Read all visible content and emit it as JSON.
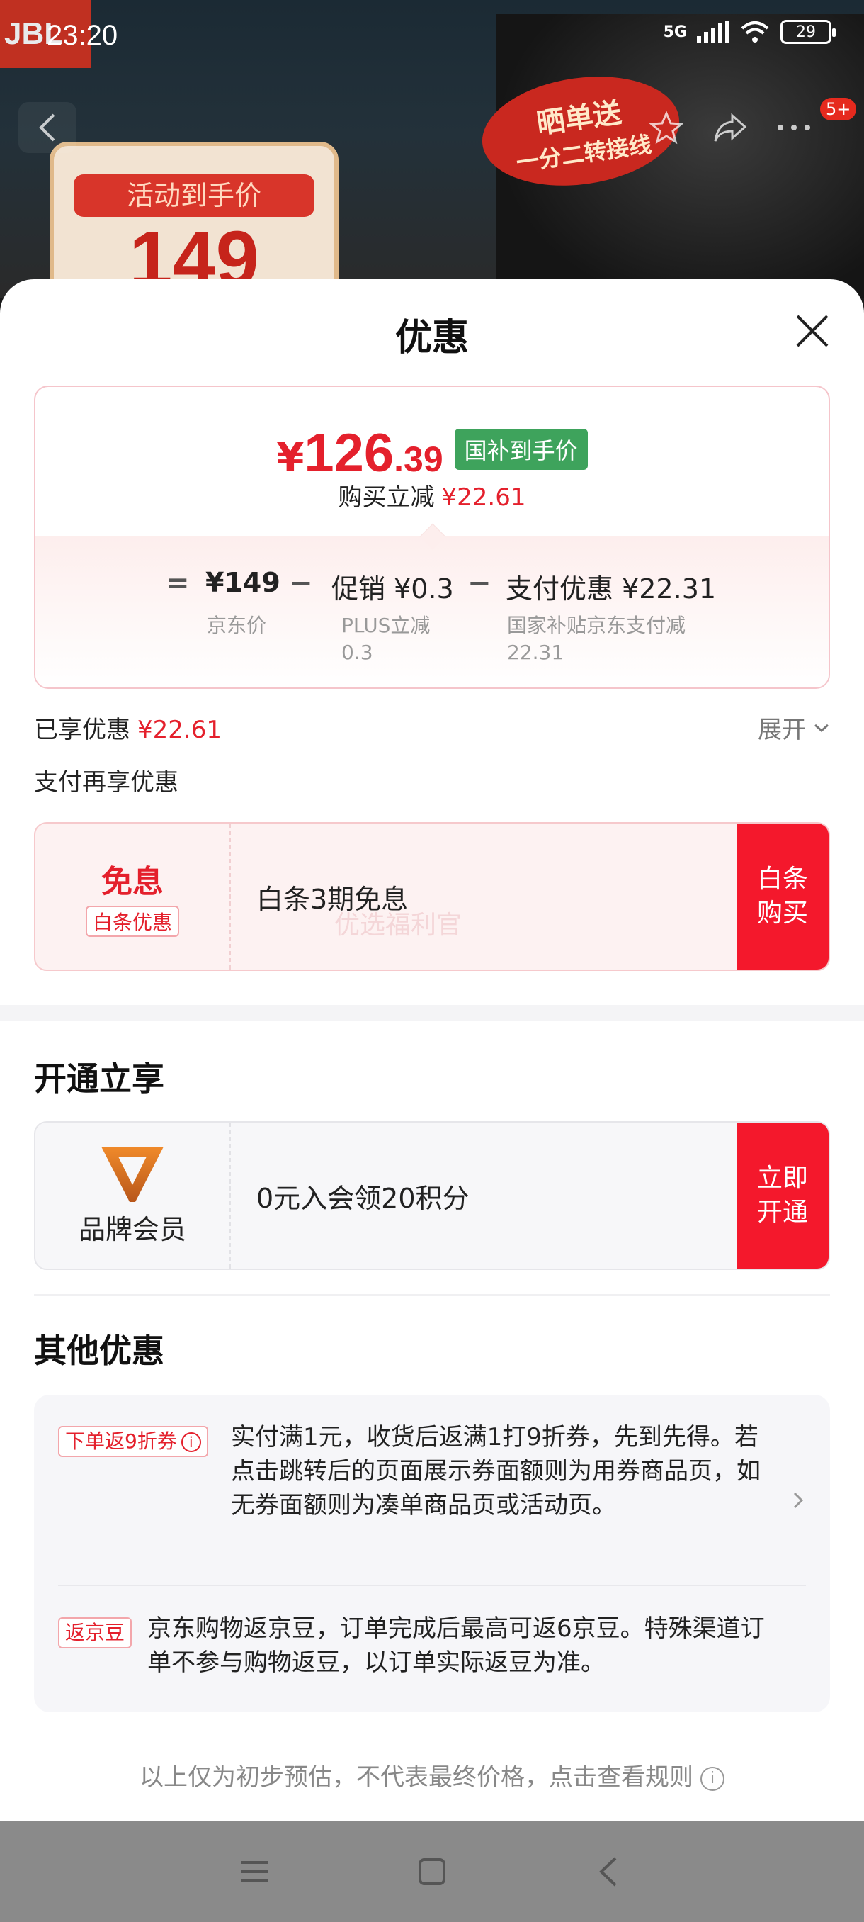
{
  "status_bar": {
    "time": "23:20",
    "network": "5G",
    "battery": "29"
  },
  "background": {
    "brand": "JBL",
    "promo_badge_line1": "晒单送",
    "promo_badge_line2": "一分二转接线",
    "price_tag": "活动到手价",
    "price_value": "149",
    "badge_count": "5+"
  },
  "sheet": {
    "title": "优惠",
    "summary": {
      "yen": "¥",
      "price_int": "126",
      "price_dec": ".39",
      "subsidy_tag": "国补到手价",
      "reduce_label": "购买立减",
      "reduce_value": "¥22.61",
      "eq": "=",
      "jd_price": "¥149",
      "minus1": "−",
      "promo": "促销 ¥0.3",
      "minus2": "−",
      "pay_discount": "支付优惠 ¥22.31",
      "jd_price_label": "京东价",
      "promo_label_1": "PLUS立减",
      "promo_label_2": "0.3",
      "pay_label_1": "国家补贴京东支付减",
      "pay_label_2": "22.31"
    },
    "enjoyed_label": "已享优惠",
    "enjoyed_value": "¥22.61",
    "expand_label": "展开",
    "pay_more_label": "支付再享优惠",
    "baitiao": {
      "big": "免息",
      "tag": "白条优惠",
      "desc": "白条3期免息",
      "btn_line1": "白条",
      "btn_line2": "购买",
      "watermark": "优选福利官"
    },
    "open_title": "开通立享",
    "member": {
      "label": "品牌会员",
      "desc": "0元入会领20积分",
      "btn_line1": "立即",
      "btn_line2": "开通"
    },
    "other_title": "其他优惠",
    "other": [
      {
        "tag": "下单返9折券",
        "text": "实付满1元，收货后返满1打9折券，先到先得。若点击跳转后的页面展示券面额则为用券商品页，如无券面额则为凑单商品页或活动页。"
      },
      {
        "tag": "返京豆",
        "text": "京东购物返京豆，订单完成后最高可返6京豆。特殊渠道订单不参与购物返豆，以订单实际返豆为准。"
      }
    ],
    "footnote": "以上仅为初步预估，不代表最终价格，点击查看规则"
  },
  "colors": {
    "accent_red": "#e4202c",
    "subsidy_green": "#3ea35c",
    "button_red": "#f4182c"
  }
}
